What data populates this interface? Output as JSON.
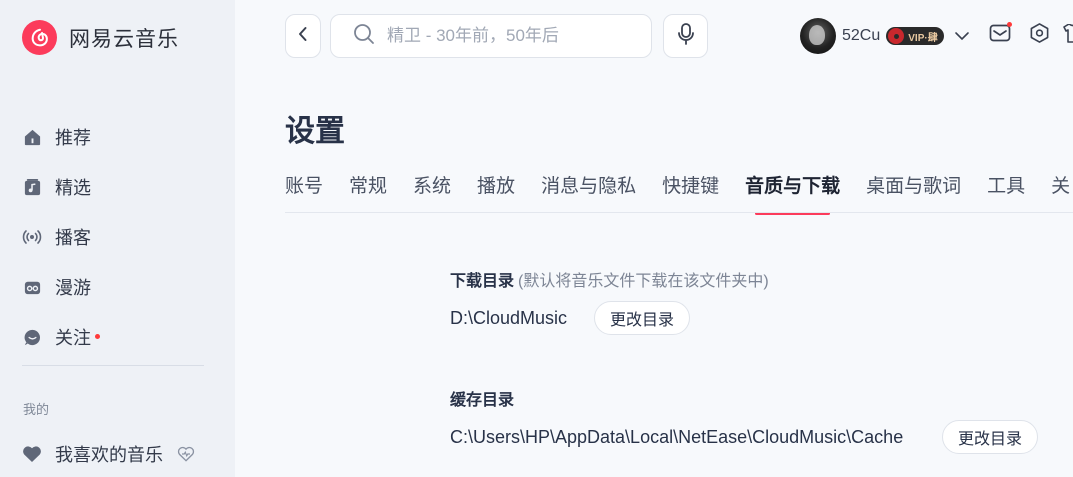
{
  "app": {
    "name": "网易云音乐",
    "brand_color": "#fc3b5b"
  },
  "sidebar": {
    "items": [
      {
        "label": "推荐",
        "icon": "home-icon"
      },
      {
        "label": "精选",
        "icon": "music-note-icon"
      },
      {
        "label": "播客",
        "icon": "broadcast-icon"
      },
      {
        "label": "漫游",
        "icon": "radio-icon"
      },
      {
        "label": "关注",
        "icon": "chat-icon",
        "has_dot": true
      }
    ],
    "section_label": "我的",
    "favorites": {
      "label": "我喜欢的音乐",
      "icon": "heart-icon",
      "action_icon": "heartbeat-icon"
    }
  },
  "topbar": {
    "search_placeholder": "精卫 - 30年前，50年后",
    "username": "52Cu",
    "vip_label": "VIP·肆"
  },
  "settings": {
    "title": "设置",
    "tabs": [
      "账号",
      "常规",
      "系统",
      "播放",
      "消息与隐私",
      "快捷键",
      "音质与下载",
      "桌面与歌词",
      "工具",
      "关"
    ],
    "active_tab": "音质与下载",
    "download": {
      "title": "下载目录",
      "hint": "(默认将音乐文件下载在该文件夹中)",
      "path": "D:\\CloudMusic",
      "button": "更改目录"
    },
    "cache": {
      "title": "缓存目录",
      "path": "C:\\Users\\HP\\AppData\\Local\\NetEase\\CloudMusic\\Cache",
      "button": "更改目录"
    }
  }
}
